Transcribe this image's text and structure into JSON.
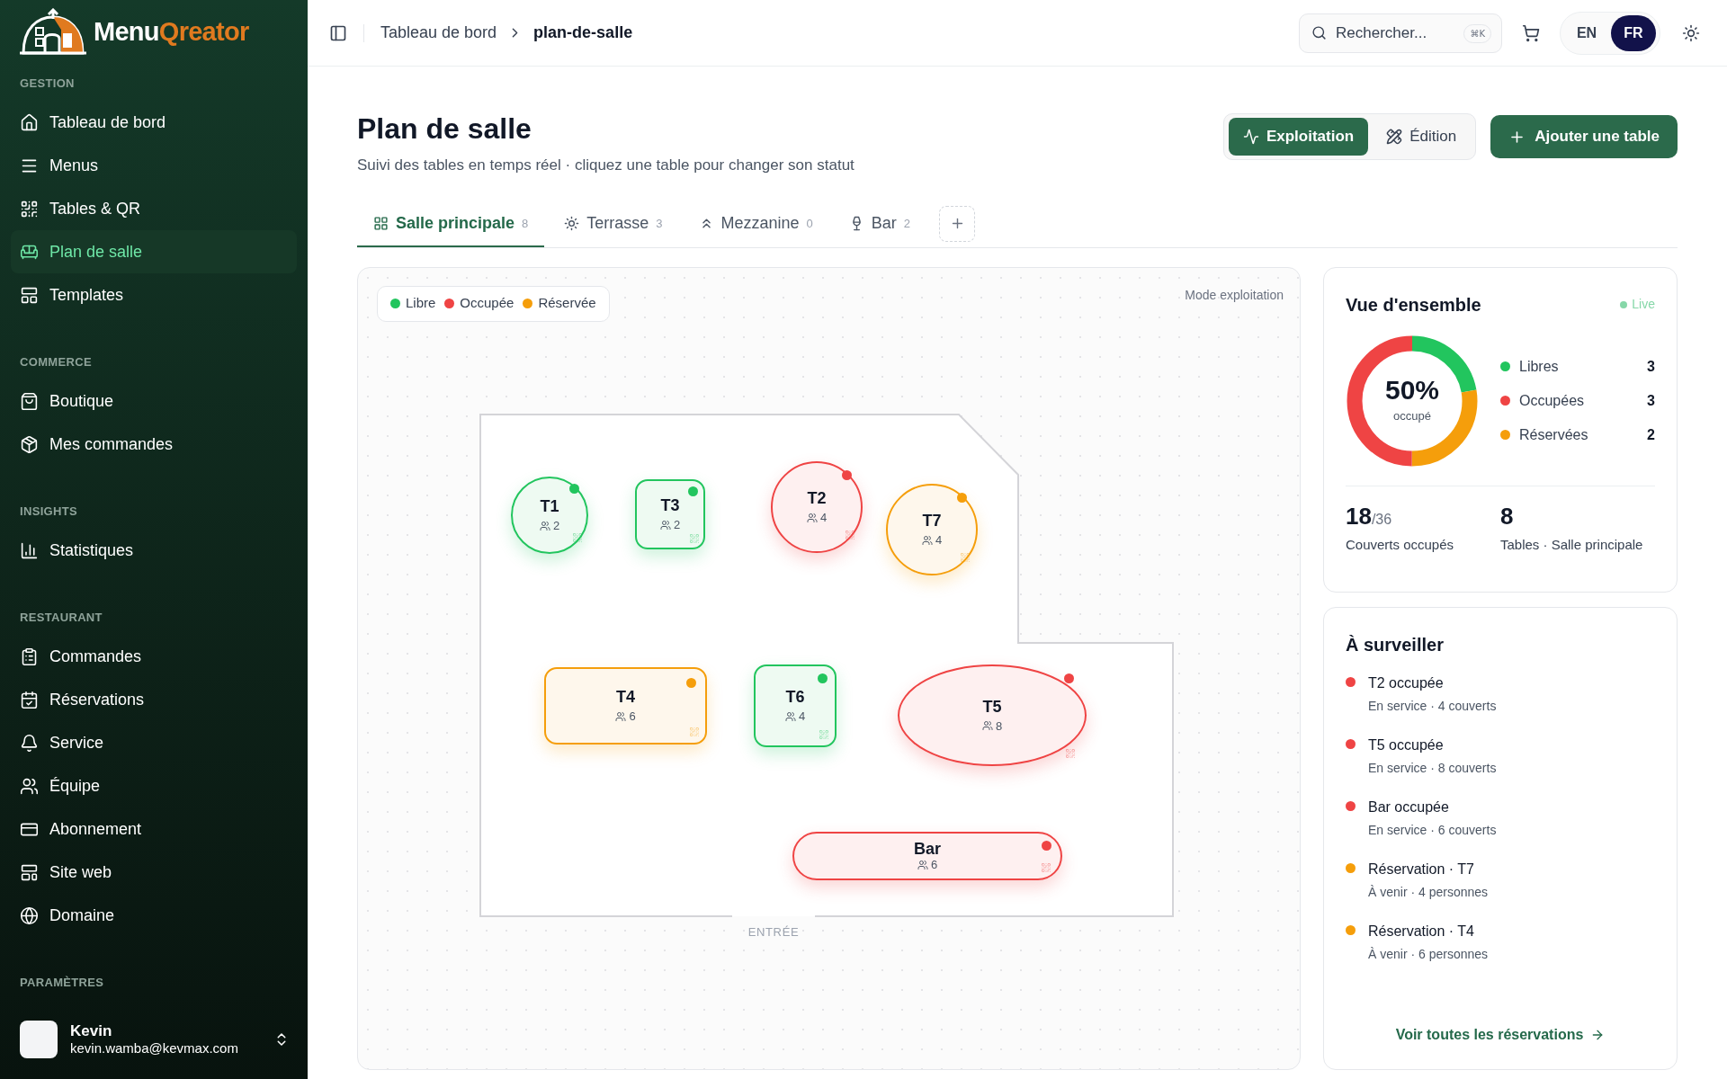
{
  "sidebar": {
    "brand": {
      "part_1": "Menu",
      "part_2": "Qreator"
    },
    "sections": [
      {
        "title": "GESTION",
        "items": [
          {
            "label": "Tableau de bord",
            "selected": false
          },
          {
            "label": "Menus",
            "selected": false
          },
          {
            "label": "Tables & QR",
            "selected": false
          },
          {
            "label": "Plan de salle",
            "selected": true
          },
          {
            "label": "Templates",
            "selected": false
          }
        ]
      },
      {
        "title": "COMMERCE",
        "items": [
          {
            "label": "Boutique",
            "selected": false
          },
          {
            "label": "Mes commandes",
            "selected": false
          }
        ]
      },
      {
        "title": "INSIGHTS",
        "items": [
          {
            "label": "Statistiques",
            "selected": false
          }
        ]
      },
      {
        "title": "RESTAURANT",
        "items": [
          {
            "label": "Commandes",
            "selected": false
          },
          {
            "label": "Réservations",
            "selected": false
          },
          {
            "label": "Service",
            "selected": false
          },
          {
            "label": "Équipe",
            "selected": false
          },
          {
            "label": "Abonnement",
            "selected": false
          },
          {
            "label": "Site web",
            "selected": false
          },
          {
            "label": "Domaine",
            "selected": false
          }
        ]
      },
      {
        "title": "PARAMÈTRES"
      }
    ],
    "user": {
      "name": "Kevin",
      "email": "kevin.wamba@kevmax.com"
    }
  },
  "header": {
    "breadcrumb": [
      "Tableau de bord",
      "plan-de-salle"
    ],
    "search": {
      "placeholder": "Rechercher...",
      "shortcut": "⌘K"
    },
    "languages": [
      {
        "label": "EN",
        "selected": false
      },
      {
        "label": "FR",
        "selected": true
      }
    ]
  },
  "page": {
    "title": "Plan de salle",
    "subtitle": "Suivi des tables en temps réel · cliquez une table pour changer son statut",
    "modes": [
      {
        "label": "Exploitation",
        "selected": true
      },
      {
        "label": "Édition",
        "selected": false
      }
    ],
    "add_button": "Ajouter une table"
  },
  "rooms": [
    {
      "label": "Salle principale",
      "count": "8",
      "selected": true
    },
    {
      "label": "Terrasse",
      "count": "3",
      "selected": false
    },
    {
      "label": "Mezzanine",
      "count": "0",
      "selected": false
    },
    {
      "label": "Bar",
      "count": "2",
      "selected": false
    }
  ],
  "canvas": {
    "legend": [
      {
        "label": "Libre",
        "color": "#22c55e"
      },
      {
        "label": "Occupée",
        "color": "#ef4444"
      },
      {
        "label": "Réservée",
        "color": "#f59e0b"
      }
    ],
    "mode_label": "Mode exploitation",
    "entrance": "ENTRÉE",
    "tables": [
      {
        "name": "T1",
        "seats": "2",
        "color": "#22c55e"
      },
      {
        "name": "T3",
        "seats": "2",
        "color": "#22c55e"
      },
      {
        "name": "T2",
        "seats": "4",
        "color": "#ef4444"
      },
      {
        "name": "T7",
        "seats": "4",
        "color": "#f59e0b"
      },
      {
        "name": "T4",
        "seats": "6",
        "color": "#f59e0b"
      },
      {
        "name": "T6",
        "seats": "4",
        "color": "#22c55e"
      },
      {
        "name": "T5",
        "seats": "8",
        "color": "#ef4444"
      },
      {
        "name": "Bar",
        "seats": "6",
        "color": "#ef4444"
      }
    ]
  },
  "overview": {
    "title": "Vue d'ensemble",
    "live": "Live",
    "center_value": "50%",
    "center_label": "occupé",
    "legend": [
      {
        "label": "Libres",
        "count": "3",
        "color": "#22c55e"
      },
      {
        "label": "Occupées",
        "count": "3",
        "color": "#ef4444"
      },
      {
        "label": "Réservées",
        "count": "2",
        "color": "#f59e0b"
      }
    ],
    "stats": [
      {
        "value": "18",
        "total": "/36",
        "label": "Couverts occupés"
      },
      {
        "value": "8",
        "label": "Tables · Salle principale"
      }
    ]
  },
  "watch": {
    "title": "À surveiller",
    "items": [
      {
        "title": "T2 occupée",
        "subtitle": "En service · 4 couverts",
        "color": "#ef4444"
      },
      {
        "title": "T5 occupée",
        "subtitle": "En service · 8 couverts",
        "color": "#ef4444"
      },
      {
        "title": "Bar occupée",
        "subtitle": "En service · 6 couverts",
        "color": "#ef4444"
      },
      {
        "title": "Réservation · T7",
        "subtitle": "À venir · 4 personnes",
        "color": "#f59e0b"
      },
      {
        "title": "Réservation · T4",
        "subtitle": "À venir · 6 personnes",
        "color": "#f59e0b"
      }
    ],
    "link": "Voir toutes les réservations"
  }
}
